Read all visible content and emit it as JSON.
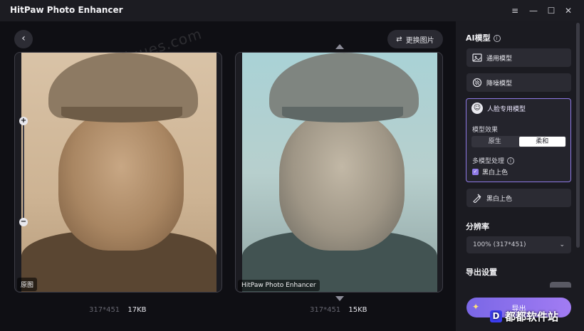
{
  "app": {
    "title": "HitPaw Photo Enhancer"
  },
  "window_controls": {
    "menu_icon": "≡",
    "minimize_icon": "—",
    "maximize_icon": "☐",
    "close_icon": "✕"
  },
  "viewer": {
    "back_icon": "‹",
    "replace_button": "更换图片",
    "watermark": "www.duduues.com",
    "left_label": "原图",
    "right_label": "HitPaw Photo Enhancer",
    "left_resolution": "317*451",
    "left_size": "17KB",
    "right_resolution": "317*451",
    "right_size": "15KB",
    "zoom_in": "+",
    "zoom_out": "−"
  },
  "panel": {
    "ai_model_title": "AI模型",
    "models": [
      {
        "label": "通用模型",
        "icon": "image-icon"
      },
      {
        "label": "降噪模型",
        "icon": "denoise-icon"
      },
      {
        "label": "人脸专用模型",
        "icon": "face-icon"
      },
      {
        "label": "黑白上色",
        "icon": "colorize-icon"
      }
    ],
    "face_model": {
      "effect_label": "模型效果",
      "options": [
        "原生",
        "柔和"
      ],
      "selected": "柔和",
      "multi_label": "多模型处理",
      "colorize_checkbox": "黑白上色",
      "colorize_checked": true
    },
    "resolution_title": "分辨率",
    "resolution_value": "100% (317*451)",
    "export_settings_title": "导出设置",
    "export_button": "导出"
  },
  "brand_watermark": {
    "logo": "D",
    "text": "都都软件站"
  },
  "colors": {
    "accent": "#8f7ae6",
    "panel_bg": "#1b1b21",
    "viewer_bg": "#0f0f14"
  }
}
